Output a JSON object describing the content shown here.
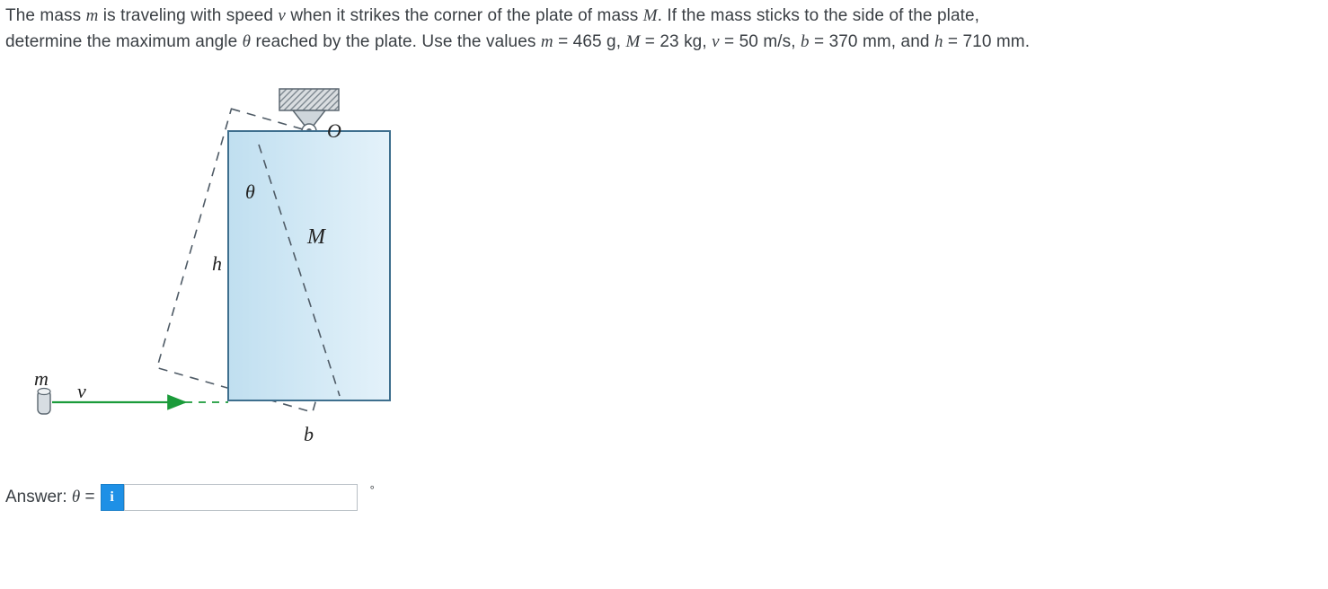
{
  "problem": {
    "line1_a": "The mass ",
    "m": "m",
    "line1_b": " is traveling with speed ",
    "vsym": "v",
    "line1_c": " when it strikes the corner of the plate of mass ",
    "M": "M",
    "line1_d": ". If the mass sticks to the side of the plate,",
    "line2_a": "determine the maximum angle ",
    "theta": "θ",
    "line2_b": " reached by the plate. Use the values ",
    "vals_m": "m",
    "eq1": " = 465 g, ",
    "vals_M": "M",
    "eq2": " = 23 kg, ",
    "vals_v": "v",
    "eq3": " = 50 m/s, ",
    "vals_b": "b",
    "eq4": " = 370 mm, and ",
    "vals_h": "h",
    "eq5": " = 710 mm."
  },
  "figure": {
    "O": "O",
    "theta": "θ",
    "M": "M",
    "h": "h",
    "b": "b",
    "m": "m",
    "v": "v"
  },
  "answer": {
    "label_a": "Answer: ",
    "label_theta": "θ",
    "label_eq": " = ",
    "info": "i",
    "value": "",
    "unit": "°"
  }
}
